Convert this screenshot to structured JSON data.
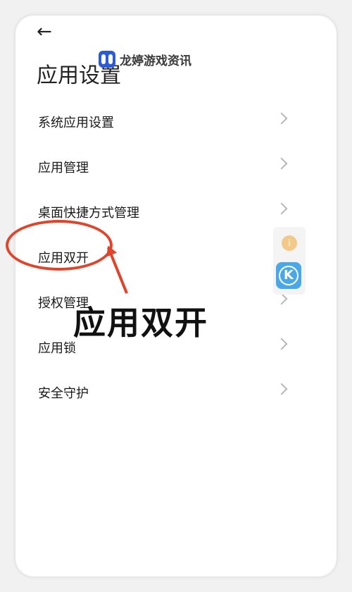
{
  "header": {
    "back_glyph": "←",
    "title": "应用设置"
  },
  "watermark": {
    "text": "龙婷游戏资讯"
  },
  "menu": {
    "items": [
      {
        "label": "系统应用设置"
      },
      {
        "label": "应用管理"
      },
      {
        "label": "桌面快捷方式管理"
      },
      {
        "label": "应用双开"
      },
      {
        "label": "授权管理"
      },
      {
        "label": "应用锁"
      },
      {
        "label": "安全守护"
      }
    ]
  },
  "annotation": {
    "text": "应用双开",
    "color": "#e0452c"
  },
  "floating_widget": {
    "top_glyph": "i",
    "app_glyph": "K"
  }
}
